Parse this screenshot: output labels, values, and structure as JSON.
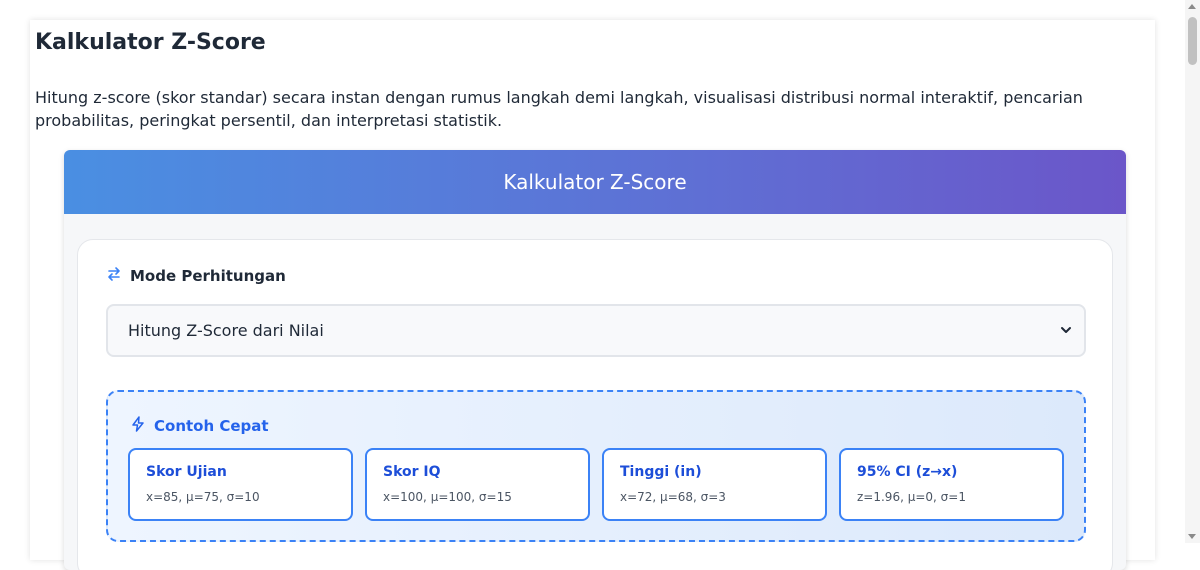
{
  "page": {
    "title": "Kalkulator Z-Score",
    "description": "Hitung z-score (skor standar) secara instan dengan rumus langkah demi langkah, visualisasi distribusi normal interaktif, pencarian probabilitas, peringkat persentil, dan interpretasi statistik."
  },
  "calculator": {
    "header_title": "Kalkulator Z-Score",
    "mode": {
      "label": "Mode Perhitungan",
      "icon": "swap-arrows-icon",
      "selected": "Hitung Z-Score dari Nilai"
    },
    "examples": {
      "title": "Contoh Cepat",
      "icon": "lightning-icon",
      "items": [
        {
          "name": "Skor Ujian",
          "values": "x=85, μ=75, σ=10"
        },
        {
          "name": "Skor IQ",
          "values": "x=100, μ=100, σ=15"
        },
        {
          "name": "Tinggi (in)",
          "values": "x=72, μ=68, σ=3"
        },
        {
          "name": "95% CI (z→x)",
          "values": "z=1.96, μ=0, σ=1"
        }
      ]
    }
  },
  "colors": {
    "accent": "#3b82f6",
    "header_gradient_start": "#4a8fe2",
    "header_gradient_end": "#6b56c9"
  }
}
